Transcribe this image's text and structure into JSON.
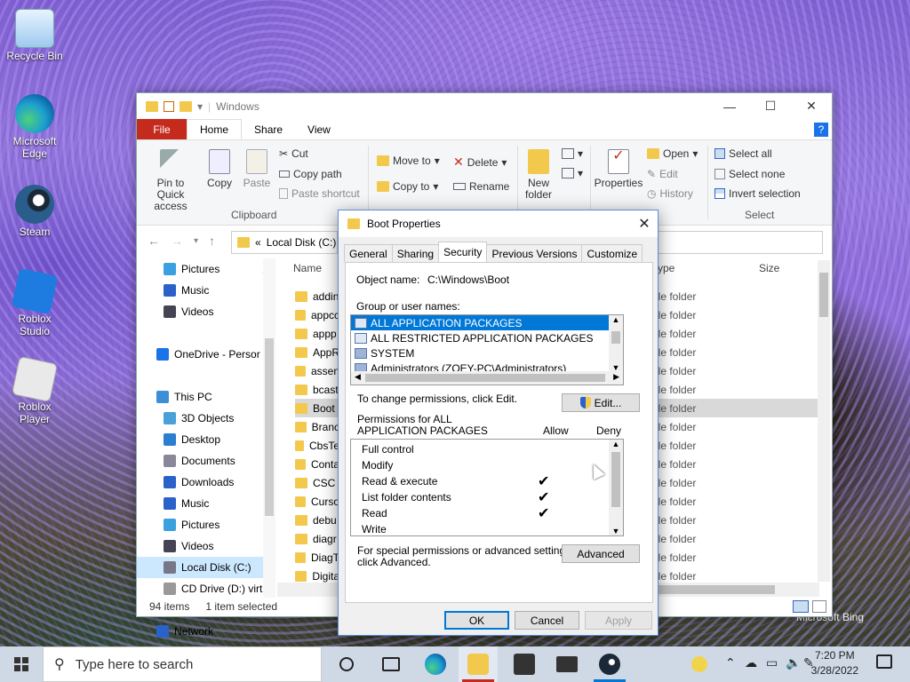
{
  "desktop": {
    "icons": [
      {
        "label": "Recycle Bin",
        "icon": "recycle-bin-icon"
      },
      {
        "label": "Microsoft Edge",
        "icon": "edge-icon"
      },
      {
        "label": "Steam",
        "icon": "steam-icon"
      },
      {
        "label": "Roblox Studio",
        "icon": "roblox-studio-icon"
      },
      {
        "label": "Roblox Player",
        "icon": "roblox-player-icon"
      }
    ],
    "watermark": "Microsoft Bing"
  },
  "explorer": {
    "title": "Windows",
    "tabs": {
      "file": "File",
      "home": "Home",
      "share": "Share",
      "view": "View"
    },
    "ribbon": {
      "pin": "Pin to Quick access",
      "copy": "Copy",
      "paste": "Paste",
      "cut": "Cut",
      "copy_path": "Copy path",
      "paste_shortcut": "Paste shortcut",
      "clipboard": "Clipboard",
      "move_to": "Move to",
      "copy_to": "Copy to",
      "delete": "Delete",
      "rename": "Rename",
      "new_folder": "New folder",
      "properties": "Properties",
      "open": "Open",
      "edit": "Edit",
      "history": "History",
      "select_all": "Select all",
      "select_none": "Select none",
      "invert_selection": "Invert selection",
      "select_group": "Select"
    },
    "address": "Local Disk (C:)",
    "address_prefix": "«",
    "nav": [
      {
        "label": "Pictures",
        "icon": "pictures-icon",
        "pinned": true
      },
      {
        "label": "Music",
        "icon": "music-icon"
      },
      {
        "label": "Videos",
        "icon": "videos-icon"
      },
      {
        "label": "",
        "icon": ""
      },
      {
        "label": "OneDrive - Persor",
        "icon": "onedrive-icon"
      },
      {
        "label": "",
        "icon": ""
      },
      {
        "label": "This PC",
        "icon": "this-pc-icon"
      },
      {
        "label": "3D Objects",
        "icon": "3d-objects-icon"
      },
      {
        "label": "Desktop",
        "icon": "desktop-icon"
      },
      {
        "label": "Documents",
        "icon": "documents-icon"
      },
      {
        "label": "Downloads",
        "icon": "downloads-icon"
      },
      {
        "label": "Music",
        "icon": "music-icon"
      },
      {
        "label": "Pictures",
        "icon": "pictures-icon"
      },
      {
        "label": "Videos",
        "icon": "videos-icon"
      },
      {
        "label": "Local Disk (C:)",
        "icon": "local-disk-icon",
        "selected": true
      },
      {
        "label": "CD Drive (D:) virt",
        "icon": "cd-drive-icon"
      },
      {
        "label": "",
        "icon": ""
      },
      {
        "label": "Network",
        "icon": "network-icon"
      }
    ],
    "columns": {
      "name": "Name",
      "type": "ype",
      "size": "Size"
    },
    "files": [
      "addin",
      "appcc",
      "appp",
      "AppR",
      "assen",
      "bcast",
      "Boot",
      "Branc",
      "CbsTe",
      "Conta",
      "CSC",
      "Curso",
      "debu",
      "diagr",
      "DiagT",
      "Digita"
    ],
    "selected_file": "Boot",
    "type_label": "ile folder",
    "status": {
      "count": "94 items",
      "selected": "1 item selected"
    }
  },
  "dialog": {
    "title": "Boot Properties",
    "tabs": [
      "General",
      "Sharing",
      "Security",
      "Previous Versions",
      "Customize"
    ],
    "active_tab": "Security",
    "object_name_label": "Object name:",
    "object_name": "C:\\Windows\\Boot",
    "group_label": "Group or user names:",
    "groups": [
      {
        "name": "ALL APPLICATION PACKAGES",
        "selected": true
      },
      {
        "name": "ALL RESTRICTED APPLICATION PACKAGES"
      },
      {
        "name": "SYSTEM"
      },
      {
        "name": "Administrators (ZOEY-PC\\Administrators)"
      }
    ],
    "change_text": "To change permissions, click Edit.",
    "edit_button": "Edit...",
    "perm_for_line1": "Permissions for ALL",
    "perm_for_line2": "APPLICATION PACKAGES",
    "allow": "Allow",
    "deny": "Deny",
    "permissions": [
      {
        "name": "Full control",
        "allow": false
      },
      {
        "name": "Modify",
        "allow": false
      },
      {
        "name": "Read & execute",
        "allow": true
      },
      {
        "name": "List folder contents",
        "allow": true
      },
      {
        "name": "Read",
        "allow": true
      },
      {
        "name": "Write",
        "allow": false
      }
    ],
    "special_line1": "For special permissions or advanced settings,",
    "special_line2": "click Advanced.",
    "advanced_button": "Advanced",
    "ok": "OK",
    "cancel": "Cancel",
    "apply": "Apply",
    "check_glyph": "✔"
  },
  "taskbar": {
    "search_placeholder": "Type here to search",
    "time": "7:20 PM",
    "date": "3/28/2022",
    "tray": [
      "chevron-up-icon",
      "network-icon",
      "speaker-icon",
      "volume-mute-icon",
      "ime-icon"
    ],
    "accent": "#0078d7"
  }
}
